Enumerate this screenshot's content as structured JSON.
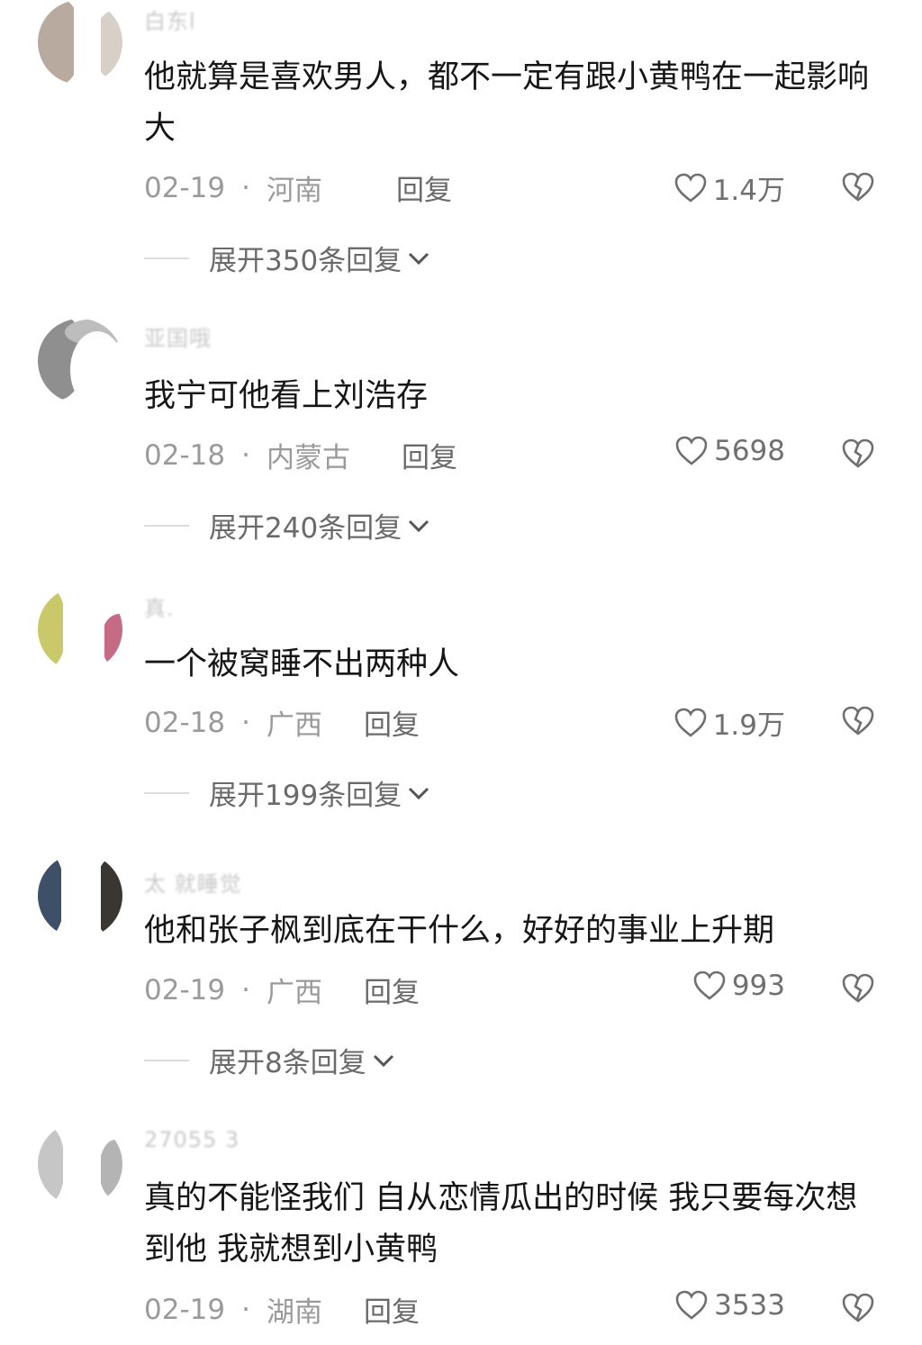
{
  "comments": [
    {
      "username": "白东l",
      "text": "他就算是喜欢男人，都不一定有跟小黄鸭在一起影响大",
      "date": "02-19",
      "region": "河南",
      "reply_label": "回复",
      "likes": "1.4万",
      "expand_label": "展开350条回复"
    },
    {
      "username": "亚国哦",
      "text": "我宁可他看上刘浩存",
      "date": "02-18",
      "region": "内蒙古",
      "reply_label": "回复",
      "likes": "5698",
      "expand_label": "展开240条回复"
    },
    {
      "username": "真.",
      "text": "一个被窝睡不出两种人",
      "date": "02-18",
      "region": "广西",
      "reply_label": "回复",
      "likes": "1.9万",
      "expand_label": "展开199条回复"
    },
    {
      "username": "太 就睡觉",
      "text": "他和张子枫到底在干什么，好好的事业上升期",
      "date": "02-19",
      "region": "广西",
      "reply_label": "回复",
      "likes": "993",
      "expand_label": "展开8条回复"
    },
    {
      "username": "27055  3",
      "text": "真的不能怪我们 自从恋情瓜出的时候 我只要每次想到他 我就想到小黄鸭",
      "date": "02-19",
      "region": "湖南",
      "reply_label": "回复",
      "likes": "3533",
      "expand_label": ""
    }
  ],
  "separator": "·",
  "icons": {
    "like": "heart-outline-icon",
    "dislike": "broken-heart-icon",
    "expand": "chevron-down-icon"
  },
  "colors": {
    "text": "#161616",
    "meta": "#9a9a9a",
    "action": "#6a6a6a",
    "background": "#ffffff"
  }
}
